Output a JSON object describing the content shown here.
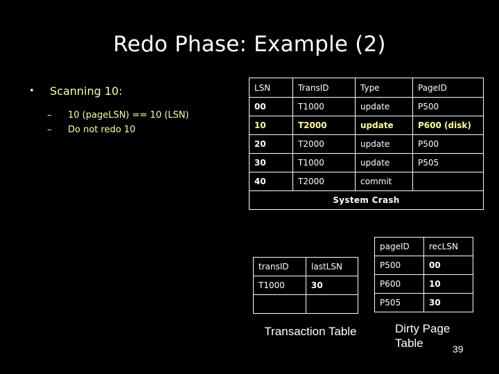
{
  "slide": {
    "title": "Redo Phase: Example (2)",
    "page_number": "39",
    "background_color": "#000000",
    "accent_color": "#ffff99",
    "text_color": "#ffffff"
  },
  "bullets": {
    "level1_marker": "•",
    "level2_marker": "–",
    "level1_text": "Scanning 10:",
    "level2": [
      "10 (pageLSN) == 10 (LSN)",
      "Do not redo 10"
    ]
  },
  "log_table": {
    "headers": [
      "LSN",
      "TransID",
      "Type",
      "PageID"
    ],
    "rows": [
      {
        "cells": [
          "00",
          "T1000",
          "update",
          "P500"
        ],
        "highlight": false
      },
      {
        "cells": [
          "10",
          "T2000",
          "update",
          "P600 (disk)"
        ],
        "highlight": true
      },
      {
        "cells": [
          "20",
          "T2000",
          "update",
          "P500"
        ],
        "highlight": false
      },
      {
        "cells": [
          "30",
          "T1000",
          "update",
          "P505"
        ],
        "highlight": false
      },
      {
        "cells": [
          "40",
          "T2000",
          "commit",
          ""
        ],
        "highlight": false
      }
    ],
    "footer_row": "System Crash"
  },
  "transaction_table": {
    "caption": "Transaction Table",
    "headers": [
      "transID",
      "lastLSN"
    ],
    "rows": [
      [
        "T1000",
        "30"
      ],
      [
        "",
        ""
      ]
    ]
  },
  "dirty_page_table": {
    "caption": "Dirty Page Table",
    "headers": [
      "pageID",
      "recLSN"
    ],
    "rows": [
      [
        "P500",
        "00"
      ],
      [
        "P600",
        "10"
      ],
      [
        "P505",
        "30"
      ]
    ]
  }
}
